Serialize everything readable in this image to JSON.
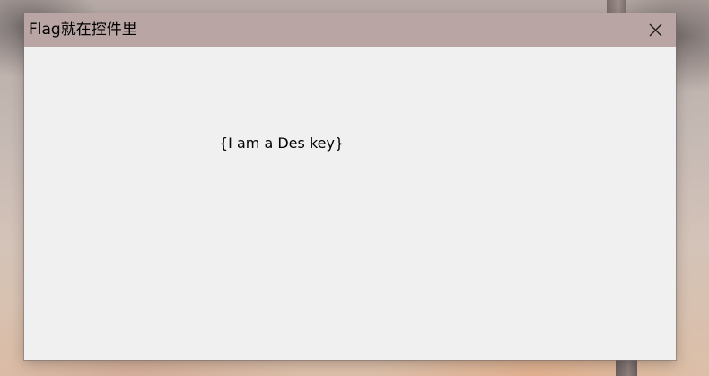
{
  "window": {
    "title": "Flag就在控件里",
    "close_icon": "close-icon"
  },
  "content": {
    "label_text": "{I am a Des key}"
  },
  "colors": {
    "titlebar": "#b9a6a4",
    "client_background": "#f0f0f0"
  }
}
